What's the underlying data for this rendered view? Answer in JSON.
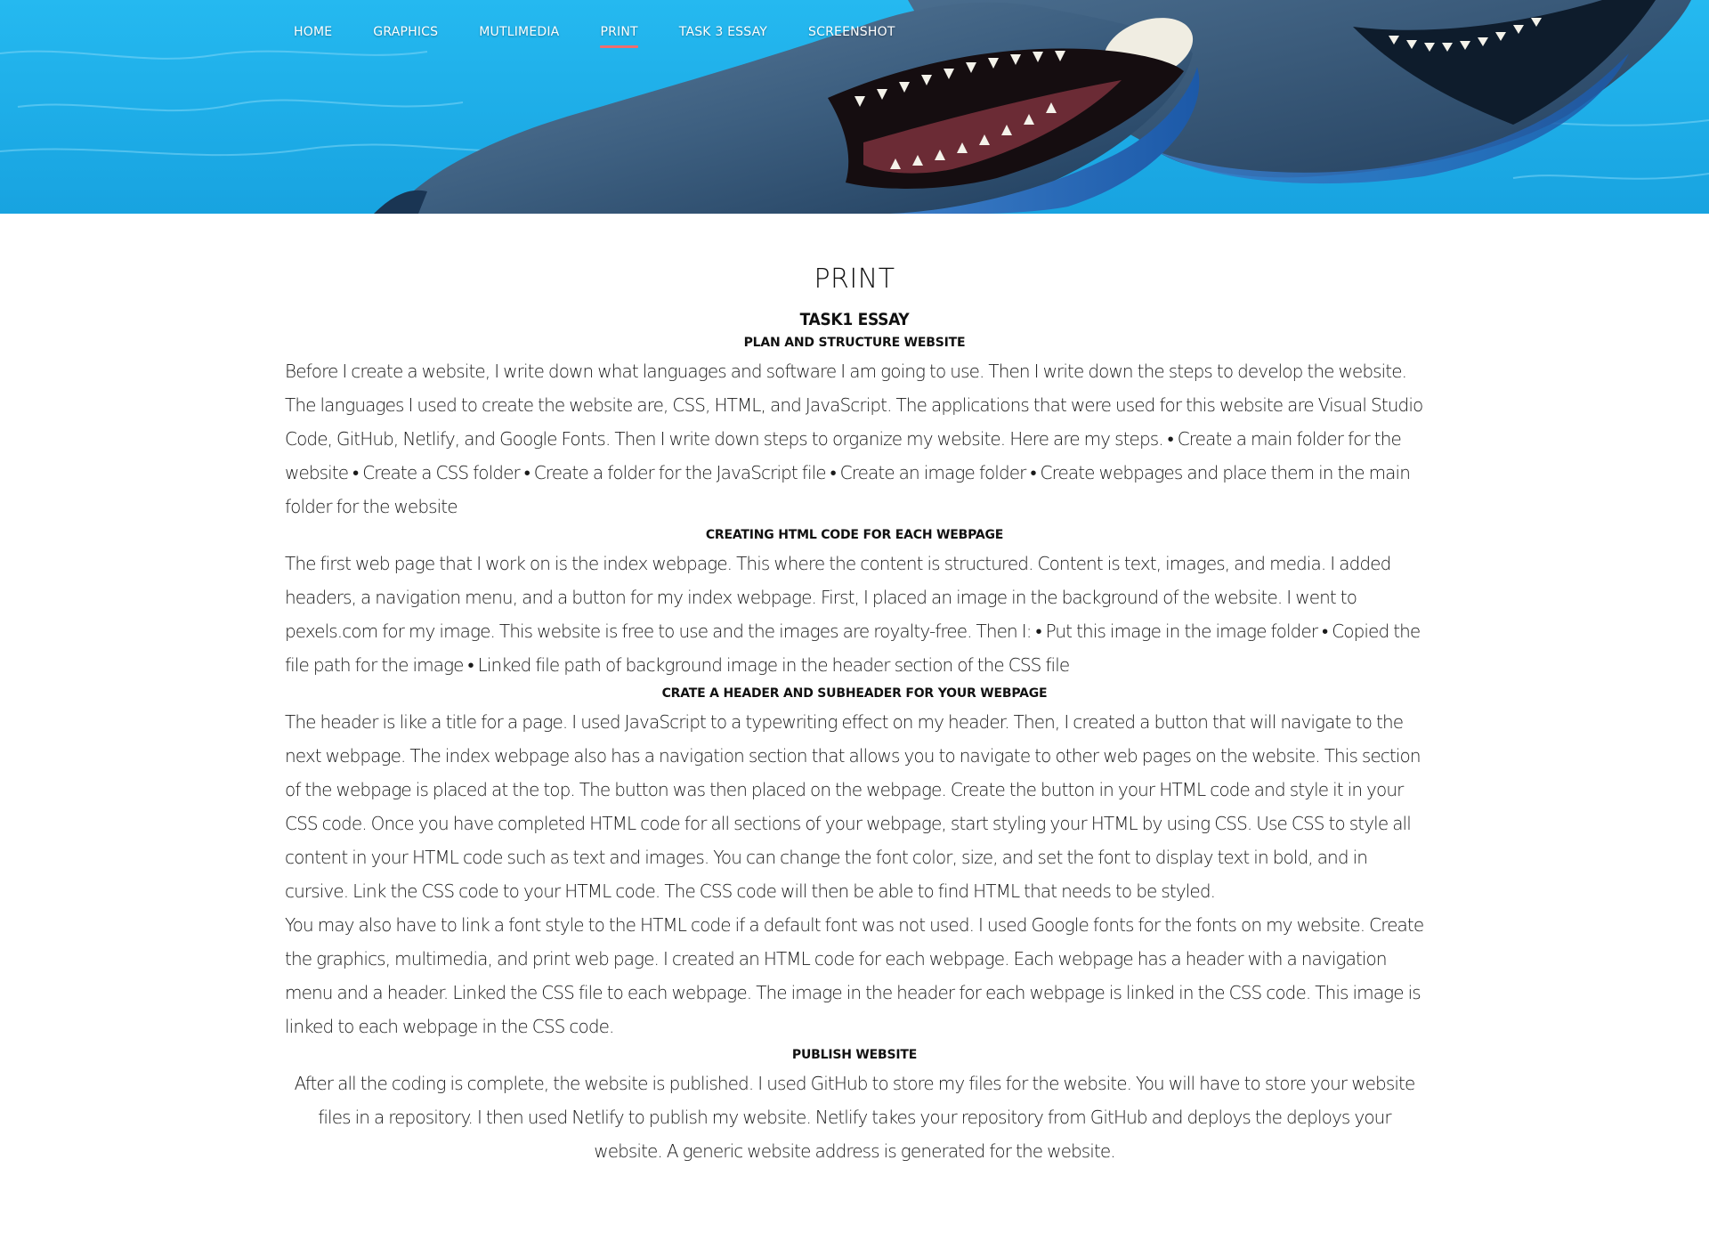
{
  "nav": {
    "items": [
      {
        "label": "HOME",
        "active": false
      },
      {
        "label": "GRAPHICS",
        "active": false
      },
      {
        "label": "MUTLIMEDIA",
        "active": false
      },
      {
        "label": "PRINT",
        "active": true
      },
      {
        "label": "TASK 3 ESSAY",
        "active": false
      },
      {
        "label": "SCREENSHOT",
        "active": false
      }
    ],
    "active_underline_color": "#f26d6d"
  },
  "hero": {
    "image": "dolphins-in-pool",
    "water_color": "#1fb3ec"
  },
  "main": {
    "page_title": "PRINT",
    "essay_title": "TASK1 ESSAY",
    "sections": [
      {
        "heading": "PLAN AND STRUCTURE WEBSITE",
        "paragraphs": [
          "Before I create a website, I write down what languages and software I am going to use. Then I write down the steps to develop the website. The languages I used to create the website are, CSS, HTML, and JavaScript. The applications that were used for this website are Visual Studio Code, GitHub, Netlify, and Google Fonts. Then I write down steps to organize my website. Here are my steps. • Create a main folder for the website • Create a CSS folder • Create a folder for the JavaScript file • Create an image folder • Create webpages and place them in the main folder for the website"
        ]
      },
      {
        "heading": "CREATING HTML CODE FOR EACH WEBPAGE",
        "paragraphs": [
          "The first web page that I work on is the index webpage. This where the content is structured. Content is text, images, and media. I added headers, a navigation menu, and a button for my index webpage. First, I placed an image in the background of the website. I went to pexels.com for my image. This website is free to use and the images are royalty-free. Then I: • Put this image in the image folder • Copied the file path for the image • Linked file path of background image in the header section of the CSS file"
        ]
      },
      {
        "heading": "CRATE A HEADER AND SUBHEADER FOR YOUR WEBPAGE",
        "paragraphs": [
          "The header is like a title for a page. I used JavaScript to a typewriting effect on my header. Then, I created a button that will navigate to the next webpage. The index webpage also has a navigation section that allows you to navigate to other web pages on the website. This section of the webpage is placed at the top. The button was then placed on the webpage. Create the button in your HTML code and style it in your CSS code. Once you have completed HTML code for all sections of your webpage, start styling your HTML by using CSS. Use CSS to style all content in your HTML code such as text and images. You can change the font color, size, and set the font to display text in bold, and in cursive. Link the CSS code to your HTML code. The CSS code will then be able to find HTML that needs to be styled.",
          "You may also have to link a font style to the HTML code if a default font was not used. I used Google fonts for the fonts on my website. Create the graphics, multimedia, and print web page. I created an HTML code for each webpage. Each webpage has a header with a navigation menu and a header. Linked the CSS file to each webpage. The image in the header for each webpage is linked in the CSS code. This image is linked to each webpage in the CSS code."
        ]
      },
      {
        "heading": "PUBLISH WEBSITE",
        "paragraphs": [
          "After all the coding is complete, the website is published. I used GitHub to store my files for the website. You will have to store your website files in a repository. I then used Netlify to publish my website. Netlify takes your repository from GitHub and deploys the deploys your website. A generic website address is generated for the website."
        ]
      }
    ]
  }
}
